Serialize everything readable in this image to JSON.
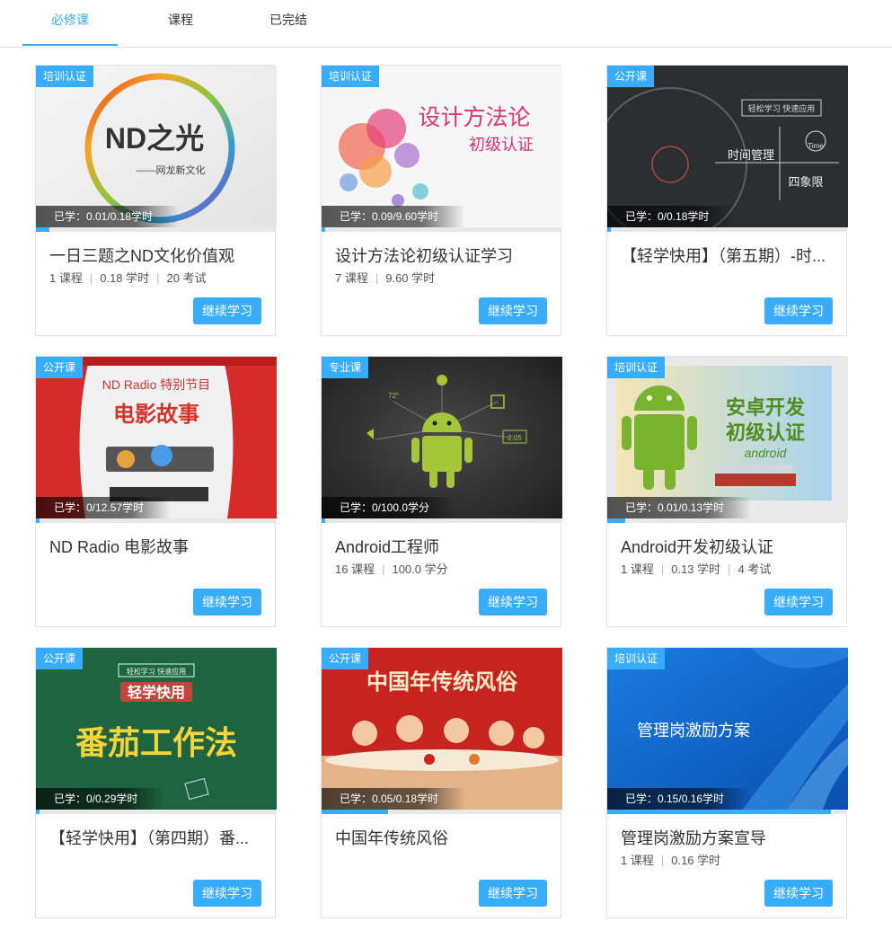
{
  "tabs": [
    "必修课",
    "课程",
    "已完结"
  ],
  "action_label": "继续学习",
  "accent": "#38adff",
  "courses": [
    {
      "badge": "培训认证",
      "studied": "已学：0.01/0.18学时",
      "progress": 0.056,
      "title": "一日三题之ND文化价值观",
      "meta": [
        "1 课程",
        "0.18 学时",
        "20 考试"
      ],
      "cover_text": [
        "ND之光",
        "——网龙新文化"
      ]
    },
    {
      "badge": "培训认证",
      "studied": "已学：0.09/9.60学时",
      "progress": 0.0094,
      "title": "设计方法论初级认证学习",
      "meta": [
        "7 课程",
        "9.60 学时"
      ],
      "cover_text": [
        "设计方法论",
        "初级认证"
      ]
    },
    {
      "badge": "公开课",
      "studied": "已学：0/0.18学时",
      "progress": 0.0,
      "title": "【轻学快用】（第五期）-时...",
      "meta": [],
      "cover_text": [
        "轻松学习 快速应用",
        "时间管理",
        "四象限",
        "Time"
      ]
    },
    {
      "badge": "公开课",
      "studied": "已学：0/12.57学时",
      "progress": 0.0,
      "title": "ND Radio 电影故事",
      "meta": [],
      "cover_text": [
        "ND Radio 特别节目",
        "电影故事"
      ]
    },
    {
      "badge": "专业课",
      "studied": "已学：0/100.0学分",
      "progress": 0.0,
      "title": "Android工程师",
      "meta": [
        "16 课程",
        "100.0 学分"
      ],
      "cover_text": [
        "72°",
        "2:05"
      ]
    },
    {
      "badge": "培训认证",
      "studied": "已学：0.01/0.13学时",
      "progress": 0.077,
      "title": "Android开发初级认证",
      "meta": [
        "1 课程",
        "0.13 学时",
        "4 考试"
      ],
      "cover_text": [
        "安卓开发",
        "初级认证",
        "android"
      ]
    },
    {
      "badge": "公开课",
      "studied": "已学：0/0.29学时",
      "progress": 0.0,
      "title": "【轻学快用】（第四期）番...",
      "meta": [],
      "cover_text": [
        "轻松学习 快速应用",
        "轻学快用",
        "番茄工作法"
      ]
    },
    {
      "badge": "公开课",
      "studied": "已学：0.05/0.18学时",
      "progress": 0.278,
      "title": "中国年传统风俗",
      "meta": [],
      "cover_text": [
        "中国年传统风俗"
      ]
    },
    {
      "badge": "培训认证",
      "studied": "已学：0.15/0.16学时",
      "progress": 0.9375,
      "title": "管理岗激励方案宣导",
      "meta": [
        "1 课程",
        "0.16 学时"
      ],
      "cover_text": [
        "管理岗激励方案"
      ]
    }
  ]
}
